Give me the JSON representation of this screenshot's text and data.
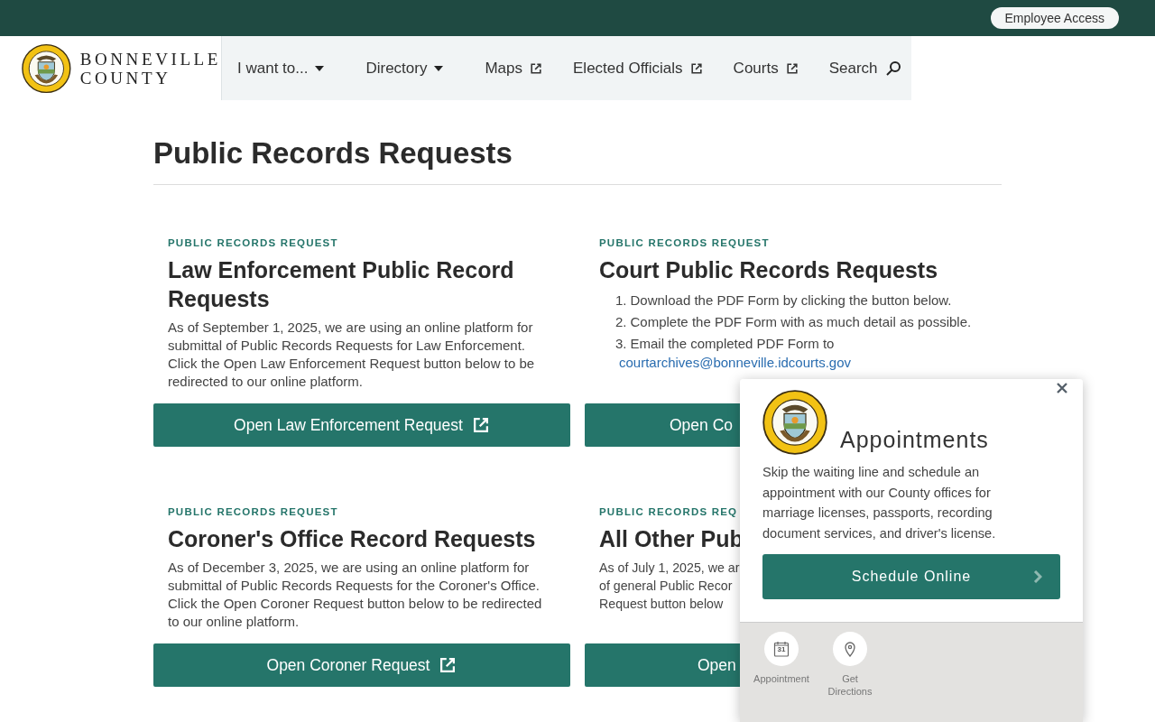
{
  "top_bar": {
    "employee_access": "Employee Access"
  },
  "header": {
    "logo_lines": [
      "BONNEVILLE",
      "COUNTY"
    ],
    "nav": [
      {
        "label": "I want to...",
        "kind": "dropdown"
      },
      {
        "label": "Directory",
        "kind": "dropdown"
      },
      {
        "label": "Maps",
        "kind": "external"
      },
      {
        "label": "Elected Officials",
        "kind": "external"
      },
      {
        "label": "Courts",
        "kind": "external"
      },
      {
        "label": "Search",
        "kind": "search"
      }
    ]
  },
  "page_title": "Public Records Requests",
  "cards": [
    {
      "kind": "text",
      "eyebrow": "PUBLIC RECORDS REQUEST",
      "title": "Law Enforcement Public Record Requests",
      "body_lines": [
        "As of September 1, 2025, we are using an online platform for submittal of Public Records Requests for Law Enforcement. Click the Open Law Enforcement Request button below to be redirected to our online platform."
      ],
      "button": {
        "label": "Open Law Enforcement Request",
        "cut": false
      }
    },
    {
      "kind": "steps",
      "eyebrow": "PUBLIC RECORDS REQUEST",
      "title": "Court Public Records Requests",
      "steps": [
        {
          "number": "1.",
          "text": "Download the PDF Form by clicking the button below."
        },
        {
          "number": "2.",
          "text": "Complete the PDF Form with as much detail as possible."
        },
        {
          "number": "3.",
          "text": "Email the completed PDF Form to"
        }
      ],
      "email": "courtarchives@bonneville.idcourts.gov",
      "button": {
        "label": "Open Co",
        "cut": true
      }
    },
    {
      "kind": "text",
      "eyebrow": "PUBLIC RECORDS REQUEST",
      "title": "Coroner's Office Record Requests",
      "body_lines": [
        "As of December 3, 2025, we are using an online platform for submittal of Public Records Requests for the Coroner's Office. Click the Open Coroner Request button below to be redirected to our online platform."
      ],
      "button": {
        "label": "Open Coroner Request",
        "cut": false
      }
    },
    {
      "kind": "text",
      "eyebrow": "PUBLIC RECORDS REQ",
      "title": "All Other Pub",
      "body_lines": [
        "As of July 1, 2025, we ar",
        "of general Public Recor",
        "Request button below"
      ],
      "button": {
        "label": "Open",
        "cut": true
      }
    }
  ],
  "popup": {
    "title": "Appointments",
    "body": "Skip the waiting line and schedule an appointment with our County offices for marriage licenses, passports, recording document services, and driver's license.",
    "button": "Schedule Online",
    "shortcuts": [
      {
        "kind": "calendar",
        "label": "Appointment",
        "day": "31"
      },
      {
        "kind": "pin",
        "label": "Get Directions"
      }
    ]
  }
}
